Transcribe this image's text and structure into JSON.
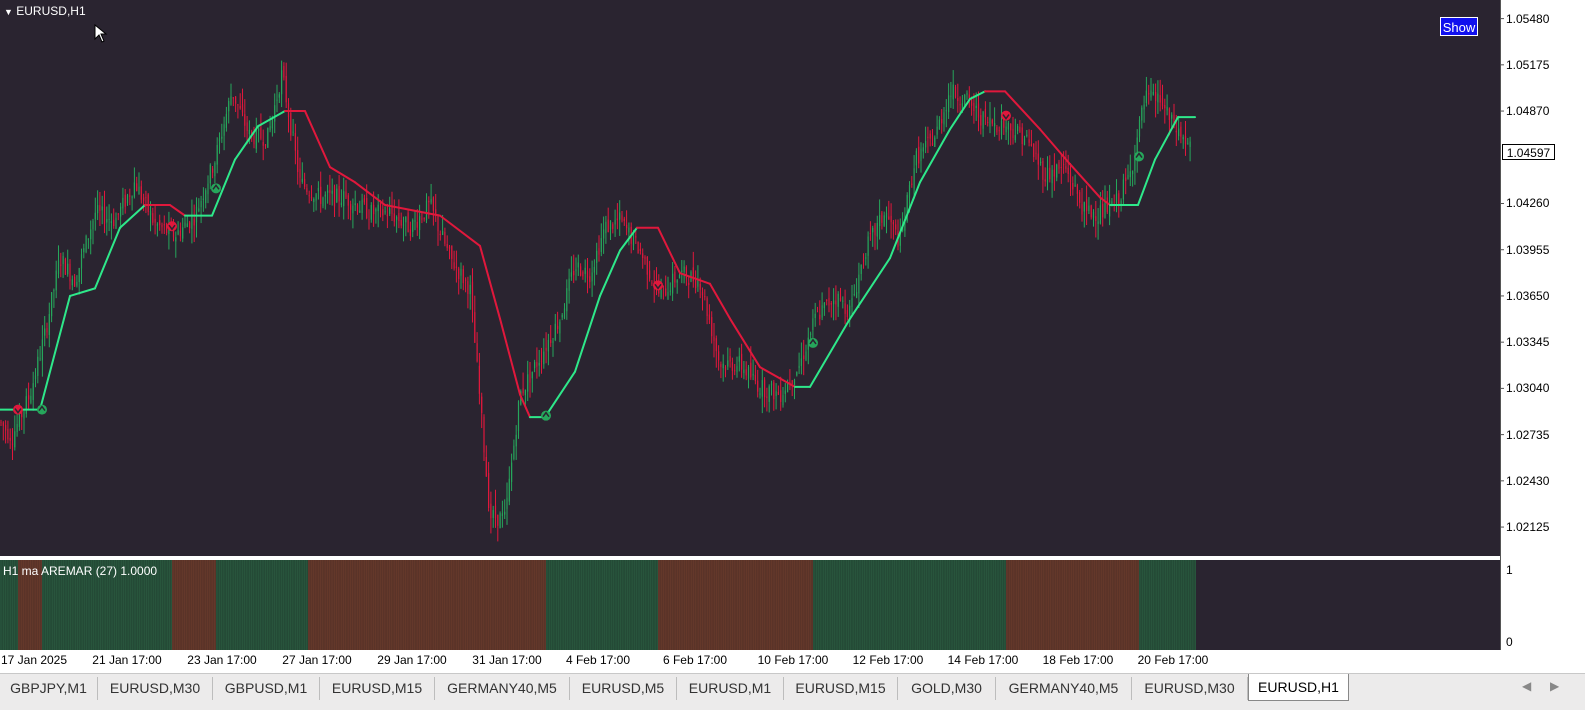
{
  "chart_title": "EURUSD,H1",
  "show_button": "Show",
  "indicator_title": "H1 ma AREMAR (27) 1.0000",
  "current_price": "1.04597",
  "price_axis": [
    "1.05480",
    "1.05175",
    "1.04870",
    "1.04260",
    "1.03955",
    "1.03650",
    "1.03345",
    "1.03040",
    "1.02735",
    "1.02430",
    "1.02125"
  ],
  "indicator_axis": [
    "1",
    "0"
  ],
  "time_axis": [
    "17 Jan 2025",
    "21 Jan 17:00",
    "23 Jan 17:00",
    "27 Jan 17:00",
    "29 Jan 17:00",
    "31 Jan 17:00",
    "4 Feb 17:00",
    "6 Feb 17:00",
    "10 Feb 17:00",
    "12 Feb 17:00",
    "14 Feb 17:00",
    "18 Feb 17:00",
    "20 Feb 17:00"
  ],
  "tabs": [
    "GBPJPY,M1",
    "EURUSD,M30",
    "GBPUSD,M1",
    "EURUSD,M15",
    "GERMANY40,M5",
    "EURUSD,M5",
    "EURUSD,M1",
    "EURUSD,M15",
    "GOLD,M30",
    "GERMANY40,M5",
    "EURUSD,M30",
    "EURUSD,H1"
  ],
  "active_tab": "EURUSD,H1",
  "colors": {
    "background": "#2a2430",
    "bull": "#26a65b",
    "bear": "#e0183c",
    "ma_up": "#2ee88a",
    "ma_down": "#e0183c",
    "ind_green": "#244a36",
    "ind_brown": "#5a3328"
  },
  "chart_data": {
    "type": "line",
    "ylim": [
      1.02,
      1.0555
    ],
    "ma_points": [
      [
        0,
        1.029,
        "down"
      ],
      [
        40,
        1.029,
        "up"
      ],
      [
        70,
        1.0365,
        "up"
      ],
      [
        95,
        1.037,
        "up"
      ],
      [
        120,
        1.041,
        "up"
      ],
      [
        145,
        1.0425,
        "up"
      ],
      [
        170,
        1.0425,
        "down"
      ],
      [
        185,
        1.0418,
        "down"
      ],
      [
        212,
        1.0418,
        "up"
      ],
      [
        235,
        1.0455,
        "up"
      ],
      [
        258,
        1.0477,
        "up"
      ],
      [
        285,
        1.0487,
        "up"
      ],
      [
        305,
        1.0487,
        "down"
      ],
      [
        330,
        1.045,
        "down"
      ],
      [
        355,
        1.044,
        "down"
      ],
      [
        385,
        1.0425,
        "down"
      ],
      [
        440,
        1.0418,
        "down"
      ],
      [
        480,
        1.0398,
        "down"
      ],
      [
        500,
        1.035,
        "down"
      ],
      [
        520,
        1.03,
        "down"
      ],
      [
        530,
        1.0285,
        "down"
      ],
      [
        545,
        1.0285,
        "up"
      ],
      [
        575,
        1.0315,
        "up"
      ],
      [
        600,
        1.0365,
        "up"
      ],
      [
        620,
        1.0395,
        "up"
      ],
      [
        637,
        1.041,
        "up"
      ],
      [
        658,
        1.041,
        "down"
      ],
      [
        680,
        1.038,
        "down"
      ],
      [
        710,
        1.0373,
        "down"
      ],
      [
        730,
        1.035,
        "down"
      ],
      [
        760,
        1.0318,
        "down"
      ],
      [
        795,
        1.0305,
        "down"
      ],
      [
        810,
        1.0305,
        "up"
      ],
      [
        850,
        1.035,
        "up"
      ],
      [
        890,
        1.039,
        "up"
      ],
      [
        920,
        1.044,
        "up"
      ],
      [
        950,
        1.0475,
        "up"
      ],
      [
        970,
        1.0495,
        "up"
      ],
      [
        985,
        1.05,
        "up"
      ],
      [
        1005,
        1.05,
        "down"
      ],
      [
        1040,
        1.0475,
        "down"
      ],
      [
        1070,
        1.0452,
        "down"
      ],
      [
        1100,
        1.043,
        "down"
      ],
      [
        1110,
        1.0425,
        "down"
      ],
      [
        1138,
        1.0425,
        "up"
      ],
      [
        1155,
        1.0455,
        "up"
      ],
      [
        1178,
        1.0483,
        "up"
      ],
      [
        1195,
        1.0483,
        "up"
      ]
    ],
    "price_path": [
      [
        0,
        1.0282
      ],
      [
        12,
        1.0272
      ],
      [
        30,
        1.03
      ],
      [
        45,
        1.034
      ],
      [
        60,
        1.039
      ],
      [
        75,
        1.0375
      ],
      [
        95,
        1.042
      ],
      [
        115,
        1.0415
      ],
      [
        135,
        1.044
      ],
      [
        155,
        1.0412
      ],
      [
        175,
        1.0405
      ],
      [
        195,
        1.0418
      ],
      [
        215,
        1.0455
      ],
      [
        232,
        1.05
      ],
      [
        250,
        1.047
      ],
      [
        268,
        1.047
      ],
      [
        282,
        1.0512
      ],
      [
        300,
        1.044
      ],
      [
        320,
        1.043
      ],
      [
        345,
        1.043
      ],
      [
        370,
        1.042
      ],
      [
        390,
        1.042
      ],
      [
        410,
        1.041
      ],
      [
        430,
        1.0425
      ],
      [
        450,
        1.039
      ],
      [
        470,
        1.037
      ],
      [
        490,
        1.022
      ],
      [
        505,
        1.0218
      ],
      [
        520,
        1.03
      ],
      [
        540,
        1.0325
      ],
      [
        560,
        1.035
      ],
      [
        575,
        1.0385
      ],
      [
        590,
        1.038
      ],
      [
        605,
        1.041
      ],
      [
        620,
        1.0415
      ],
      [
        640,
        1.0395
      ],
      [
        660,
        1.0365
      ],
      [
        680,
        1.038
      ],
      [
        700,
        1.0375
      ],
      [
        720,
        1.032
      ],
      [
        740,
        1.032
      ],
      [
        760,
        1.0305
      ],
      [
        780,
        1.03
      ],
      [
        800,
        1.032
      ],
      [
        815,
        1.035
      ],
      [
        835,
        1.0365
      ],
      [
        850,
        1.0355
      ],
      [
        865,
        1.0395
      ],
      [
        885,
        1.042
      ],
      [
        900,
        1.04
      ],
      [
        915,
        1.0455
      ],
      [
        935,
        1.047
      ],
      [
        950,
        1.05
      ],
      [
        965,
        1.0495
      ],
      [
        985,
        1.048
      ],
      [
        1005,
        1.0478
      ],
      [
        1025,
        1.047
      ],
      [
        1045,
        1.0445
      ],
      [
        1065,
        1.045
      ],
      [
        1085,
        1.042
      ],
      [
        1100,
        1.042
      ],
      [
        1115,
        1.0425
      ],
      [
        1130,
        1.0445
      ],
      [
        1145,
        1.0495
      ],
      [
        1160,
        1.0495
      ],
      [
        1170,
        1.048
      ],
      [
        1182,
        1.047
      ],
      [
        1192,
        1.046
      ]
    ],
    "markers": [
      {
        "x": 18,
        "y": 1.029,
        "dir": "down"
      },
      {
        "x": 42,
        "y": 1.029,
        "dir": "up"
      },
      {
        "x": 172,
        "y": 1.0411,
        "dir": "down"
      },
      {
        "x": 216,
        "y": 1.0436,
        "dir": "up"
      },
      {
        "x": 546,
        "y": 1.0286,
        "dir": "up"
      },
      {
        "x": 658,
        "y": 1.0372,
        "dir": "down"
      },
      {
        "x": 813,
        "y": 1.0334,
        "dir": "up"
      },
      {
        "x": 1006,
        "y": 1.0484,
        "dir": "down"
      },
      {
        "x": 1139,
        "y": 1.0457,
        "dir": "up"
      }
    ],
    "indicator_segments": [
      {
        "x1": 0,
        "x2": 18,
        "state": "up"
      },
      {
        "x1": 18,
        "x2": 42,
        "state": "down"
      },
      {
        "x1": 42,
        "x2": 172,
        "state": "up"
      },
      {
        "x1": 172,
        "x2": 216,
        "state": "down"
      },
      {
        "x1": 216,
        "x2": 308,
        "state": "up"
      },
      {
        "x1": 308,
        "x2": 546,
        "state": "down"
      },
      {
        "x1": 546,
        "x2": 658,
        "state": "up"
      },
      {
        "x1": 658,
        "x2": 813,
        "state": "down"
      },
      {
        "x1": 813,
        "x2": 1006,
        "state": "up"
      },
      {
        "x1": 1006,
        "x2": 1139,
        "state": "down"
      },
      {
        "x1": 1139,
        "x2": 1196,
        "state": "up"
      }
    ]
  }
}
